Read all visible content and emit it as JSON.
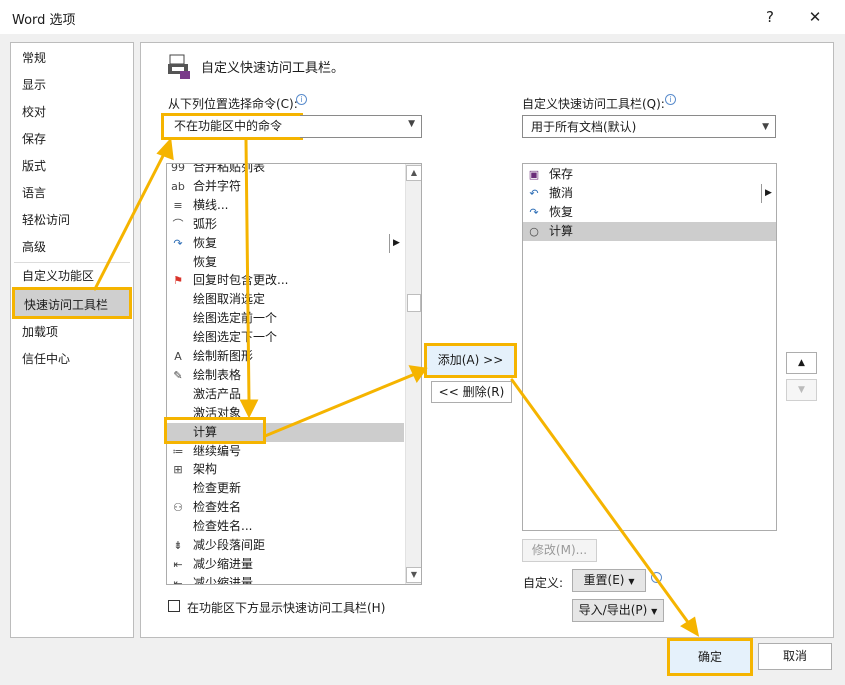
{
  "window": {
    "title": "Word 选项",
    "help_label": "?",
    "close_label": "✕"
  },
  "categories": [
    {
      "label": "常规"
    },
    {
      "label": "显示"
    },
    {
      "label": "校对"
    },
    {
      "label": "保存"
    },
    {
      "label": "版式"
    },
    {
      "label": "语言"
    },
    {
      "label": "轻松访问"
    },
    {
      "label": "高级"
    },
    {
      "label": "自定义功能区"
    },
    {
      "label": "快速访问工具栏",
      "selected": true
    },
    {
      "label": "加载项"
    },
    {
      "label": "信任中心"
    }
  ],
  "header": {
    "title": "自定义快速访问工具栏。"
  },
  "left": {
    "choose_label": "从下列位置选择命令(C):",
    "info_icon": "info-icon",
    "dropdown_value": "不在功能区中的命令",
    "commands": [
      {
        "label": "合并粘贴列表",
        "icon": "paste-icon"
      },
      {
        "label": "合并字符",
        "icon": "combine-chars-icon"
      },
      {
        "label": "横线...",
        "icon": "horizontal-line-icon"
      },
      {
        "label": "弧形",
        "icon": "arc-icon"
      },
      {
        "label": "恢复",
        "icon": "redo-icon",
        "submenu": true
      },
      {
        "label": "恢复",
        "icon": ""
      },
      {
        "label": "回复时包含更改...",
        "icon": "flag-icon"
      },
      {
        "label": "绘图取消选定",
        "icon": ""
      },
      {
        "label": "绘图选定前一个",
        "icon": ""
      },
      {
        "label": "绘图选定下一个",
        "icon": ""
      },
      {
        "label": "绘制新图形",
        "icon": "new-drawing-icon"
      },
      {
        "label": "绘制表格",
        "icon": "draw-table-icon"
      },
      {
        "label": "激活产品",
        "icon": ""
      },
      {
        "label": "激活对象",
        "icon": ""
      },
      {
        "label": "计算",
        "icon": "",
        "selected": true
      },
      {
        "label": "继续编号",
        "icon": "numbering-icon"
      },
      {
        "label": "架构",
        "icon": "schema-icon"
      },
      {
        "label": "检查更新",
        "icon": ""
      },
      {
        "label": "检查姓名",
        "icon": "check-names-icon"
      },
      {
        "label": "检查姓名...",
        "icon": ""
      },
      {
        "label": "减少段落间距",
        "icon": "decrease-spacing-icon"
      },
      {
        "label": "减少缩进量",
        "icon": "decrease-indent-icon"
      },
      {
        "label": "减少缩进量",
        "icon": "decrease-indent-icon"
      }
    ],
    "show_below_label": "在功能区下方显示快速访问工具栏(H)"
  },
  "middle": {
    "add_label": "添加(A) >>",
    "remove_label": "<< 删除(R)"
  },
  "right": {
    "customize_label": "自定义快速访问工具栏(Q):",
    "dropdown_value": "用于所有文档(默认)",
    "items": [
      {
        "label": "保存",
        "icon": "save-icon"
      },
      {
        "label": "撤消",
        "icon": "undo-icon",
        "submenu": true
      },
      {
        "label": "恢复",
        "icon": "redo-icon"
      },
      {
        "label": "计算",
        "icon": "circle-icon",
        "selected": true
      }
    ],
    "modify_label": "修改(M)...",
    "custom_label": "自定义:",
    "reset_label": "重置(E)",
    "import_export_label": "导入/导出(P)"
  },
  "footer": {
    "ok_label": "确定",
    "cancel_label": "取消"
  },
  "colors": {
    "highlight": "#f5b400",
    "selection": "#cdcdcd"
  }
}
